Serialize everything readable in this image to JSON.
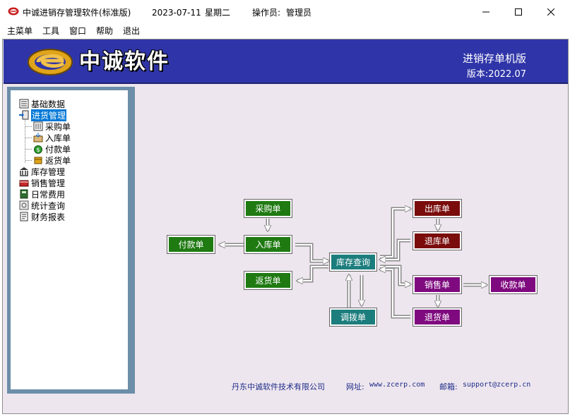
{
  "window": {
    "title": "中诚进销存管理软件(标准版)",
    "date": "2023-07-11",
    "weekday": "星期二",
    "operator_label": "操作员:",
    "operator": "管理员"
  },
  "menu": {
    "items": [
      "主菜单",
      "工具",
      "窗口",
      "帮助",
      "退出"
    ]
  },
  "banner": {
    "brand": "中诚软件",
    "edition": "进销存单机版",
    "version": "版本:2022.07"
  },
  "tree": {
    "items": [
      {
        "label": "基础数据",
        "icon": "database-icon"
      },
      {
        "label": "进货管理",
        "icon": "purchase-mgmt-icon",
        "selected": true
      },
      {
        "label": "采购单",
        "icon": "purchase-order-icon"
      },
      {
        "label": "入库单",
        "icon": "stock-in-icon"
      },
      {
        "label": "付款单",
        "icon": "payment-icon"
      },
      {
        "label": "返货单",
        "icon": "return-goods-icon"
      },
      {
        "label": "库存管理",
        "icon": "warehouse-icon"
      },
      {
        "label": "销售管理",
        "icon": "sales-icon"
      },
      {
        "label": "日常费用",
        "icon": "expense-icon"
      },
      {
        "label": "统计查询",
        "icon": "statistics-icon"
      },
      {
        "label": "财务报表",
        "icon": "report-icon"
      }
    ]
  },
  "flow": {
    "purchase_order": "采购单",
    "stock_in": "入库单",
    "payment": "付款单",
    "return_goods": "返货单",
    "inventory_query": "库存查询",
    "transfer": "调拨单",
    "stock_out": "出库单",
    "stock_return": "退库单",
    "sales_order": "销售单",
    "sales_return": "退货单",
    "receipt": "收款单"
  },
  "footer": {
    "company": "丹东中诚软件技术有限公司",
    "website_label": "网址:",
    "website": "www.zcerp.com",
    "email_label": "邮箱:",
    "email": "support@zcerp.cn"
  },
  "colors": {
    "banner": "#2f35a8",
    "sidebar_border": "#6c8ea8",
    "workspace": "#eee6ee",
    "green": "#1f7a12",
    "teal": "#1c7d7d",
    "maroon": "#7a0c0c",
    "purple": "#7f0a7f"
  }
}
